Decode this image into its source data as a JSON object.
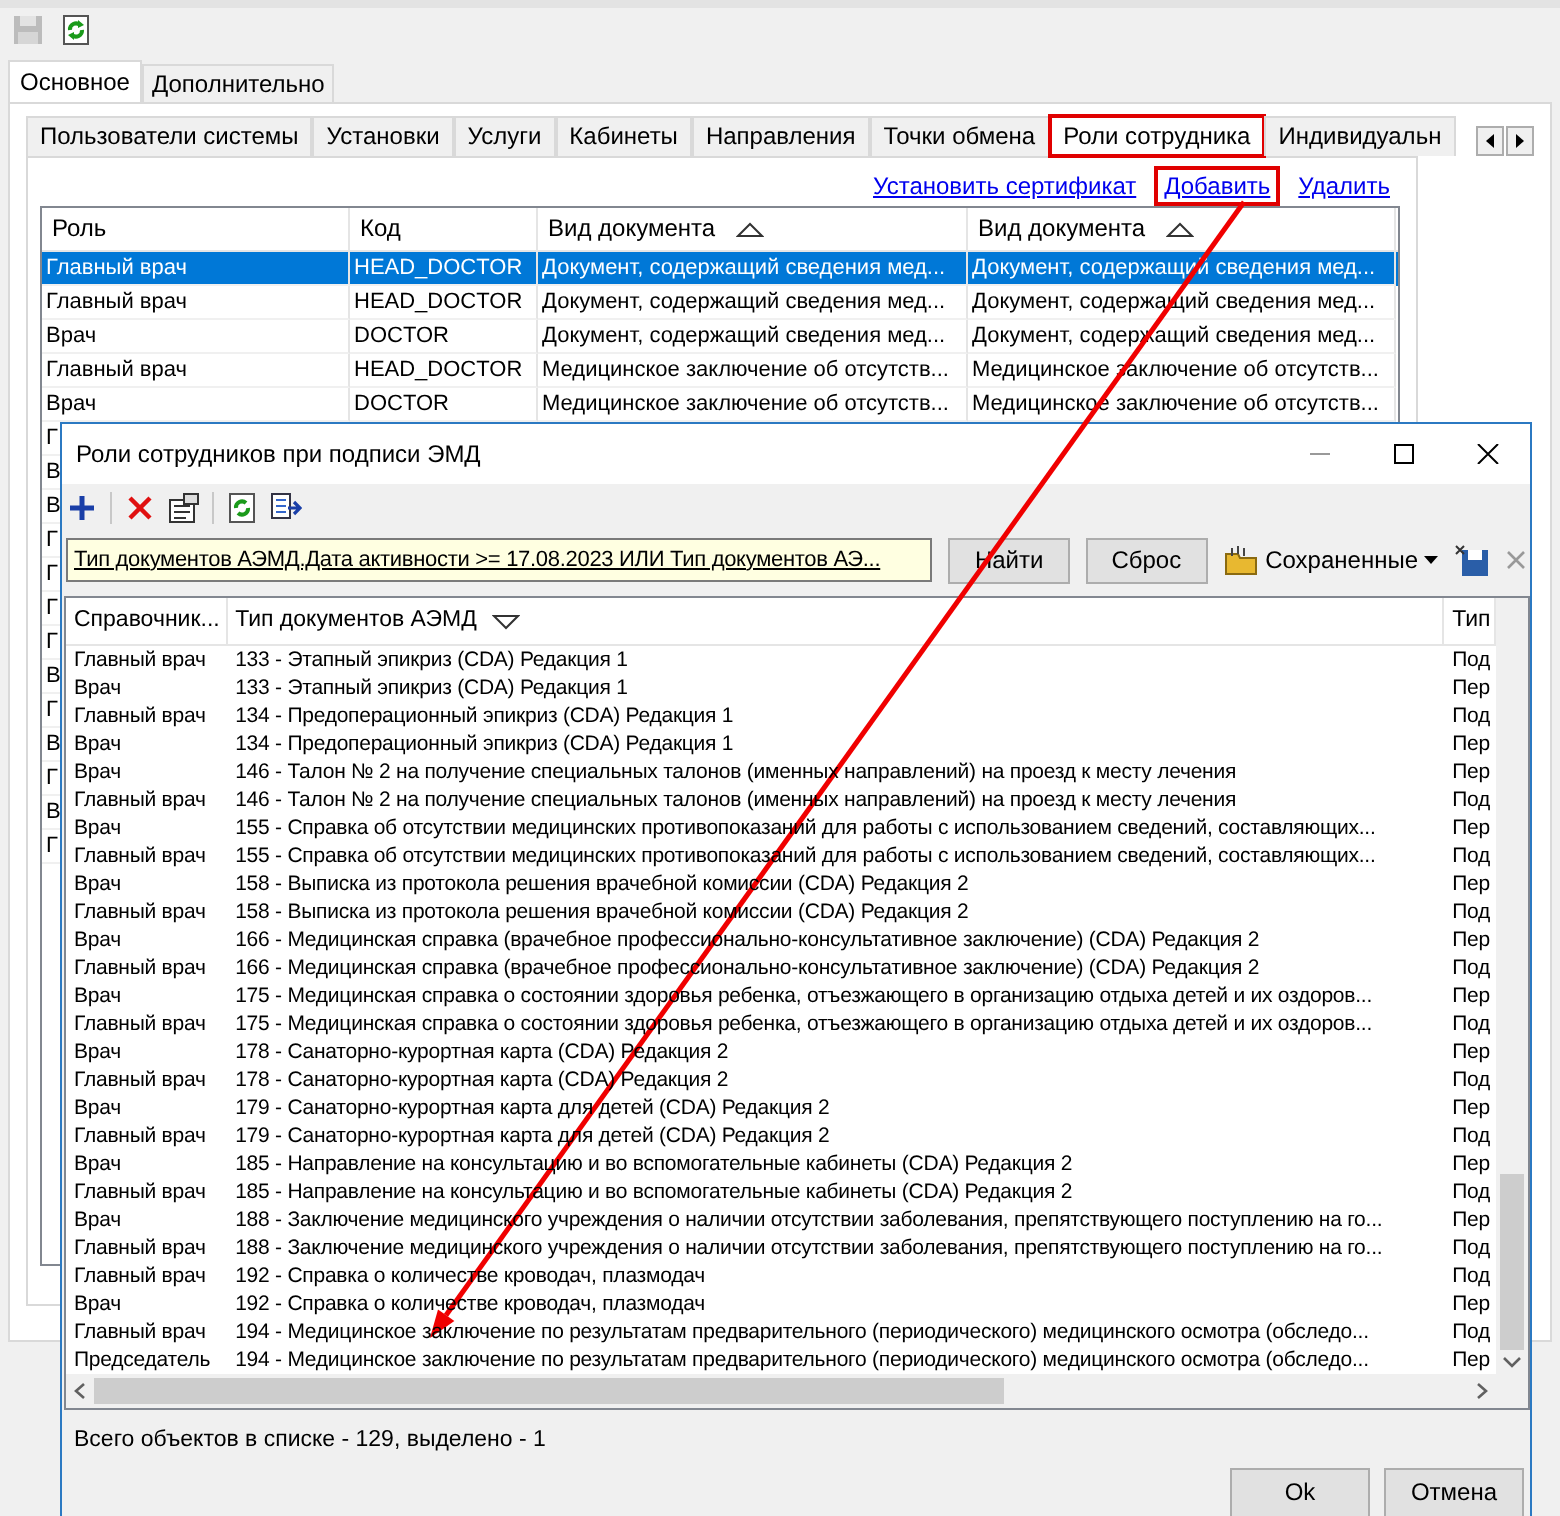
{
  "toolbar": [
    {
      "kind": "save",
      "disabled": true
    },
    {
      "kind": "refresh",
      "disabled": false
    }
  ],
  "main_tabs": [
    {
      "label": "Основное",
      "selected": true
    },
    {
      "label": "Дополнительно",
      "selected": false
    }
  ],
  "sub_tabs": [
    {
      "label": "Пользователи системы",
      "selected": false,
      "highlighted": false
    },
    {
      "label": "Установки",
      "selected": false,
      "highlighted": false
    },
    {
      "label": "Услуги",
      "selected": false,
      "highlighted": false
    },
    {
      "label": "Кабинеты",
      "selected": false,
      "highlighted": false
    },
    {
      "label": "Направления",
      "selected": false,
      "highlighted": false
    },
    {
      "label": "Точки обмена",
      "selected": false,
      "highlighted": false
    },
    {
      "label": "Роли сотрудника",
      "selected": true,
      "highlighted": true
    },
    {
      "label": "Индивидуальн",
      "selected": false,
      "highlighted": false
    }
  ],
  "links": [
    {
      "label": "Установить сертификат",
      "highlighted": false
    },
    {
      "label": "Добавить",
      "highlighted": true
    },
    {
      "label": "Удалить",
      "highlighted": false
    }
  ],
  "roles_table": {
    "columns": [
      {
        "label": "Роль",
        "sorted_ascending": false,
        "sorted_descending": false
      },
      {
        "label": "Код",
        "sorted_ascending": false,
        "sorted_descending": false
      },
      {
        "label": "Вид документа",
        "sorted_ascending": true,
        "sorted_descending": false
      },
      {
        "label": "Вид документа",
        "sorted_ascending": true,
        "sorted_descending": false
      }
    ],
    "rows": [
      {
        "selected": true,
        "cells": [
          "Главный врач",
          "HEAD_DOCTOR",
          "Документ, содержащий сведения мед...",
          "Документ, содержащий сведения мед..."
        ]
      },
      {
        "selected": false,
        "cells": [
          "Главный врач",
          "HEAD_DOCTOR",
          "Документ, содержащий сведения мед...",
          "Документ, содержащий сведения мед..."
        ]
      },
      {
        "selected": false,
        "cells": [
          "Врач",
          "DOCTOR",
          "Документ, содержащий сведения мед...",
          "Документ, содержащий сведения мед..."
        ]
      },
      {
        "selected": false,
        "cells": [
          "Главный врач",
          "HEAD_DOCTOR",
          "Медицинское заключение об отсутств...",
          "Медицинское заключение об отсутств..."
        ]
      },
      {
        "selected": false,
        "cells": [
          "Врач",
          "DOCTOR",
          "Медицинское заключение об отсутств...",
          "Медицинское заключение об отсутств..."
        ]
      },
      {
        "selected": false,
        "cells": [
          "Г"
        ]
      },
      {
        "selected": false,
        "cells": [
          "В"
        ]
      },
      {
        "selected": false,
        "cells": [
          "В"
        ]
      },
      {
        "selected": false,
        "cells": [
          "Г"
        ]
      },
      {
        "selected": false,
        "cells": [
          "Г"
        ]
      },
      {
        "selected": false,
        "cells": [
          "Г"
        ]
      },
      {
        "selected": false,
        "cells": [
          "Г"
        ]
      },
      {
        "selected": false,
        "cells": [
          "В"
        ]
      },
      {
        "selected": false,
        "cells": [
          "Г"
        ]
      },
      {
        "selected": false,
        "cells": [
          "В"
        ]
      },
      {
        "selected": false,
        "cells": [
          "Г"
        ]
      },
      {
        "selected": false,
        "cells": [
          "В"
        ]
      },
      {
        "selected": false,
        "cells": [
          "Г"
        ]
      }
    ]
  },
  "dialog": {
    "title": "Роли сотрудников при подписи ЭМД",
    "filter": {
      "value": "Тип документов АЭМД.Дата активности >= 17.08.2023 ИЛИ Тип документов АЭ..."
    },
    "filter_buttons": [
      "Найти",
      "Сброс"
    ],
    "saved_menu": {
      "label": "Сохраненные"
    },
    "grid": {
      "columns": [
        {
          "label": "Справочник...",
          "sorted_ascending": false,
          "sorted_descending": false
        },
        {
          "label": "Тип документов АЭМД",
          "sorted_ascending": false,
          "sorted_descending": true
        },
        {
          "label": "Тип",
          "sorted_ascending": false,
          "sorted_descending": false
        }
      ],
      "rows": [
        [
          "Главный врач",
          "133 - Этапный эпикриз (CDA) Редакция 1",
          "Под"
        ],
        [
          "Врач",
          "133 - Этапный эпикриз (CDA) Редакция 1",
          "Пер"
        ],
        [
          "Главный врач",
          "134 - Предоперационный эпикриз (CDA) Редакция 1",
          "Под"
        ],
        [
          "Врач",
          "134 - Предоперационный эпикриз (CDA) Редакция 1",
          "Пер"
        ],
        [
          "Врач",
          "146 - Талон № 2 на получение специальных талонов (именных направлений) на проезд к месту лечения",
          "Пер"
        ],
        [
          "Главный врач",
          "146 - Талон № 2 на получение специальных талонов (именных направлений) на проезд к месту лечения",
          "Под"
        ],
        [
          "Врач",
          "155 - Справка об отсутствии медицинских противопоказаний для работы с использованием сведений, составляющих...",
          "Пер"
        ],
        [
          "Главный врач",
          "155 - Справка об отсутствии медицинских противопоказаний для работы с использованием сведений, составляющих...",
          "Под"
        ],
        [
          "Врач",
          "158 - Выписка из протокола решения врачебной комиссии (CDA) Редакция 2",
          "Пер"
        ],
        [
          "Главный врач",
          "158 - Выписка из протокола решения врачебной комиссии (CDA) Редакция 2",
          "Под"
        ],
        [
          "Врач",
          "166 - Медицинская справка (врачебное профессионально-консультативное заключение) (CDA) Редакция 2",
          "Пер"
        ],
        [
          "Главный врач",
          "166 - Медицинская справка (врачебное профессионально-консультативное заключение) (CDA) Редакция 2",
          "Под"
        ],
        [
          "Врач",
          "175 - Медицинская справка о состоянии здоровья ребенка, отъезжающего в организацию отдыха детей и их оздоров...",
          "Пер"
        ],
        [
          "Главный врач",
          "175 - Медицинская справка о состоянии здоровья ребенка, отъезжающего в организацию отдыха детей и их оздоров...",
          "Под"
        ],
        [
          "Врач",
          "178 - Санаторно-курортная карта (CDA) Редакция 2",
          "Пер"
        ],
        [
          "Главный врач",
          "178 - Санаторно-курортная карта (CDA) Редакция 2",
          "Под"
        ],
        [
          "Врач",
          "179 - Санаторно-курортная карта для детей (CDA) Редакция 2",
          "Пер"
        ],
        [
          "Главный врач",
          "179 - Санаторно-курортная карта для детей (CDA) Редакция 2",
          "Под"
        ],
        [
          "Врач",
          "185 - Направление на консультацию и во вспомогательные кабинеты (CDA) Редакция 2",
          "Пер"
        ],
        [
          "Главный врач",
          "185 - Направление на консультацию и во вспомогательные кабинеты (CDA) Редакция 2",
          "Под"
        ],
        [
          "Врач",
          "188 - Заключение медицинского учреждения о наличии отсутствии заболевания, препятствующего поступлению на го...",
          "Пер"
        ],
        [
          "Главный врач",
          "188 - Заключение медицинского учреждения о наличии отсутствии заболевания, препятствующего поступлению на го...",
          "Под"
        ],
        [
          "Главный врач",
          "192 - Справка о количестве кроводач, плазмодач",
          "Под"
        ],
        [
          "Врач",
          "192 - Справка о количестве кроводач, плазмодач",
          "Пер"
        ],
        [
          "Главный врач",
          "194 - Медицинское заключение по результатам предварительного (периодического) медицинского осмотра (обследо...",
          "Под"
        ],
        [
          "Председатель",
          "194 - Медицинское заключение по результатам предварительного (периодического) медицинского осмотра (обследо...",
          "Пер"
        ]
      ]
    },
    "status": "Всего объектов в списке - 129, выделено - 1",
    "footer_buttons": [
      "Ok",
      "Отмена"
    ]
  }
}
